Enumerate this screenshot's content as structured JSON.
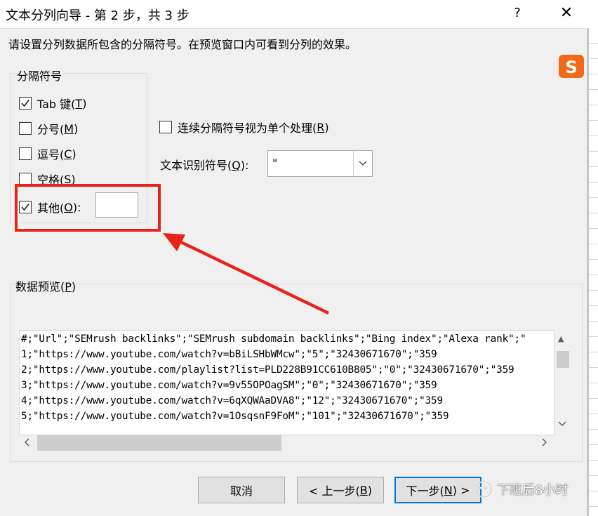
{
  "window": {
    "title": "文本分列向导 - 第 2 步，共 3 步",
    "help_glyph": "?",
    "close_glyph": "✕"
  },
  "instruction": "请设置分列数据所包含的分隔符号。在预览窗口内可看到分列的效果。",
  "delimiters": {
    "group_title": "分隔符号",
    "tab": {
      "label": "Tab 键(",
      "key": "T",
      "suffix": ")",
      "checked": true
    },
    "semicolon": {
      "label": "分号(",
      "key": "M",
      "suffix": ")",
      "checked": false
    },
    "comma": {
      "label": "逗号(",
      "key": "C",
      "suffix": ")",
      "checked": false
    },
    "space": {
      "label": "空格(",
      "key": "S",
      "suffix": ")",
      "checked": false
    },
    "other": {
      "label": "其他(",
      "key": "O",
      "suffix": "):",
      "checked": true,
      "value": ""
    }
  },
  "consecutive": {
    "label": "连续分隔符号视为单个处理(",
    "key": "R",
    "suffix": ")",
    "checked": false
  },
  "text_qualifier": {
    "label": "文本识别符号(",
    "key": "Q",
    "suffix": "):",
    "value": "\""
  },
  "preview": {
    "title": "数据预览(",
    "key": "P",
    "suffix": ")",
    "lines": [
      "#;\"Url\";\"SEMrush backlinks\";\"SEMrush subdomain backlinks\";\"Bing index\";\"Alexa rank\";\"",
      "1;\"https://www.youtube.com/watch?v=bBiLSHbWMcw\";\"5\";\"32430671670\";\"359",
      "2;\"https://www.youtube.com/playlist?list=PLD228B91CC610B805\";\"0\";\"32430671670\";\"359",
      "3;\"https://www.youtube.com/watch?v=9v55OPOagSM\";\"0\";\"32430671670\";\"359",
      "4;\"https://www.youtube.com/watch?v=6qXQWAaDVA8\";\"12\";\"32430671670\";\"359",
      "5;\"https://www.youtube.com/watch?v=1OsqsnF9FoM\";\"101\";\"32430671670\";\"359"
    ]
  },
  "buttons": {
    "cancel": "取消",
    "back": {
      "label": "< 上一步(",
      "key": "B",
      "suffix": ")"
    },
    "next": {
      "label": "下一步(",
      "key": "N",
      "suffix": ") >"
    }
  },
  "watermark": "下班后8小时",
  "colors": {
    "highlight": "#e8231c",
    "accent": "#0078d7",
    "sogou": "#f06a1a"
  }
}
